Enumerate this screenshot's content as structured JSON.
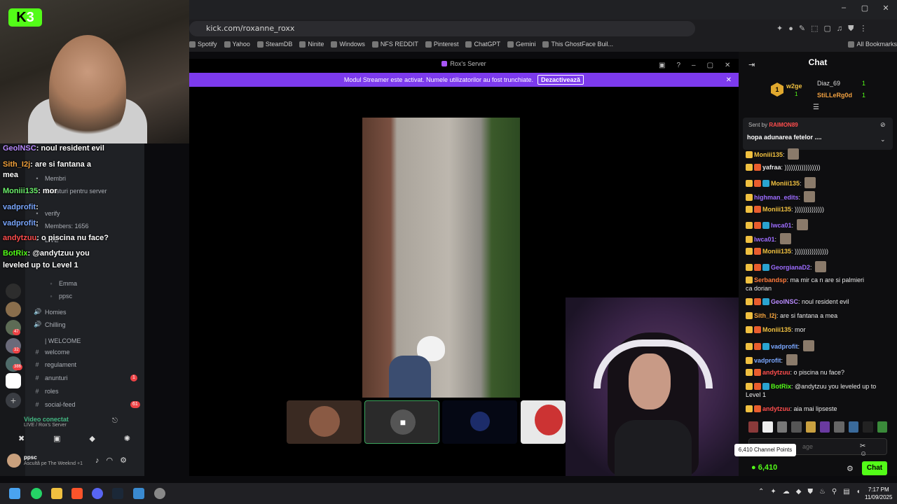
{
  "kick_logo": {
    "letter": "K",
    "number": "3"
  },
  "browser": {
    "url": "kick.com/roxanne_roxx",
    "bookmarks": [
      "Spotify",
      "Yahoo",
      "SteamDB",
      "Ninite",
      "Windows",
      "NFS REDDIT",
      "Pinterest",
      "ChatGPT",
      "Gemini",
      "This GhostFace Buil...",
      "All Bookmarks"
    ]
  },
  "overlay_chat": [
    {
      "user": "GeolNSC",
      "text": "noul resident evil",
      "color": "#b98bff"
    },
    {
      "user": "Sith_I2j",
      "text": "are si fantana a",
      "color": "#f3a23c"
    },
    {
      "user": "",
      "text": "mea",
      "color": "#fff"
    },
    {
      "user": "Moniii135",
      "text": "mor",
      "color": "#6cf06c"
    },
    {
      "user": "vadprofit",
      "text": "",
      "color": "#7aa7ff"
    },
    {
      "user": "vadprofit",
      "text": "",
      "color": "#7aa7ff"
    },
    {
      "user": "andytzuu",
      "text": "o piscina nu face?",
      "color": "#ff4d4d"
    },
    {
      "user": "BotRix",
      "text": "@andytzuu you",
      "color": "#53fc18"
    },
    {
      "user": "",
      "text": "leveled up to Level 1",
      "color": "#fff"
    }
  ],
  "discord": {
    "channels_top": [
      "Membri",
      "Boosturi pentru server",
      "verify",
      "Members: 1656",
      "LIVE"
    ],
    "voice_users": [
      "Emma",
      "ppsc"
    ],
    "voice_channels": [
      "Homies",
      "Chilling"
    ],
    "category": "| WELCOME",
    "text_channels": [
      "welcome",
      "regulament",
      "anunturi",
      "roles",
      "social-feed"
    ],
    "badges": {
      "anunturi": "1",
      "social-feed": "61"
    },
    "server_badges": [
      "47",
      "32",
      "386"
    ],
    "voice_status": "Video conectat",
    "voice_sub": "LIVE / Rox's Server",
    "user": "ppsc",
    "user_activity": "Ascultă pe The Weeknd +1"
  },
  "call": {
    "title": "Rox's Server",
    "banner_text": "Modul Streamer este activat. Numele utilizatorilor au fost trunchiate.",
    "banner_button": "Dezactivează"
  },
  "chat": {
    "header": "Chat",
    "top_gifters": [
      {
        "rank": "1",
        "user": "w2ge",
        "count": "1"
      },
      {
        "user": "Diaz_69",
        "count": "1"
      },
      {
        "user": "StiLLeRg0d",
        "count": "1"
      }
    ],
    "pinned": {
      "sent_by": "Sent by",
      "user": "RAIMON89",
      "text": "hopa adunarea fetelor ...."
    },
    "messages": [
      {
        "user": "Moniii135",
        "text": "",
        "color": "#f0c040"
      },
      {
        "user": "yafraa",
        "text": ")))))))))))))))))",
        "color": "#e8e8e8"
      },
      {
        "user": "Moniii135",
        "text": "",
        "color": "#f0c040"
      },
      {
        "user": "highman_edits",
        "text": "",
        "color": "#9d6cff"
      },
      {
        "user": "Moniii135",
        "text": "))))))))))))))",
        "color": "#f0c040"
      },
      {
        "user": "lwca01",
        "text": "",
        "color": "#9d6cff"
      },
      {
        "user": "lwca01",
        "text": "",
        "color": "#9d6cff"
      },
      {
        "user": "Moniii135",
        "text": "))))))))))))))))",
        "color": "#f0c040"
      },
      {
        "user": "GeorgianaD2",
        "text": "",
        "color": "#9d6cff"
      },
      {
        "user": "Serbandsp",
        "text": "ma mir ca n are si palmieri",
        "color": "#ff7a3c"
      },
      {
        "user": "",
        "text": "ca dorian",
        "color": "#e8e8e8"
      },
      {
        "user": "GeolNSC",
        "text": "noul resident evil",
        "color": "#b98bff"
      },
      {
        "user": "Sith_I2j",
        "text": "are si fantana a mea",
        "color": "#f3a23c"
      },
      {
        "user": "Moniii135",
        "text": "mor",
        "color": "#f0c040"
      },
      {
        "user": "vadprofit",
        "text": "",
        "color": "#7aa7ff"
      },
      {
        "user": "vadprofit",
        "text": "",
        "color": "#7aa7ff"
      },
      {
        "user": "andytzuu",
        "text": "o piscina nu face?",
        "color": "#ff4d4d"
      },
      {
        "user": "BotRix",
        "text": "@andytzuu you leveled up to",
        "color": "#53fc18"
      },
      {
        "user": "",
        "text": "Level 1",
        "color": "#e8e8e8"
      },
      {
        "user": "andytzuu",
        "text": "aia mai lipseste",
        "color": "#ff4d4d"
      }
    ],
    "input_placeholder": "age",
    "points_tooltip": "6,410 Channel Points",
    "points": "6,410",
    "send_label": "Chat"
  },
  "taskbar": {
    "time": "7:17 PM",
    "date": "11/09/2025"
  }
}
